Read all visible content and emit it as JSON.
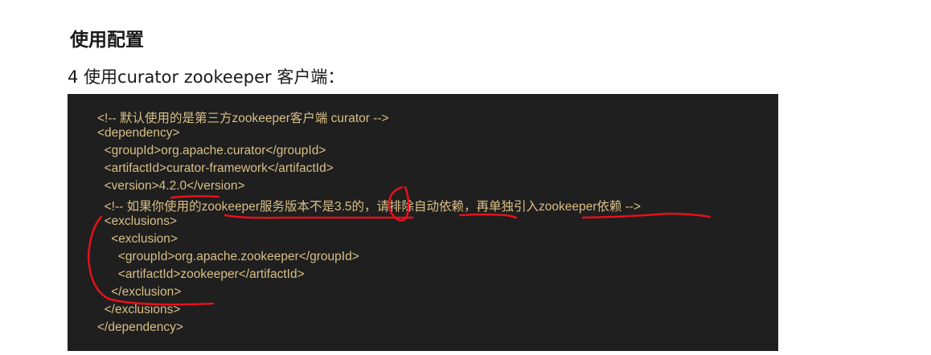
{
  "heading": "使用配置",
  "subheading": "4 使用curator  zookeeper 客户端：",
  "code_lines": [
    "<!-- 默认使用的是第三方zookeeper客户端 curator -->",
    "<dependency>",
    "  <groupId>org.apache.curator</groupId>",
    "  <artifactId>curator-framework</artifactId>",
    "  <version>4.2.0</version>",
    "  <!-- 如果你使用的zookeeper服务版本不是3.5的，请排除自动依赖，再单独引入zookeeper依赖 -->",
    "  <exclusions>",
    "    <exclusion>",
    "      <groupId>org.apache.zookeeper</groupId>",
    "      <artifactId>zookeeper</artifactId>",
    "    </exclusion>",
    "  </exclusions>",
    "</dependency>"
  ]
}
